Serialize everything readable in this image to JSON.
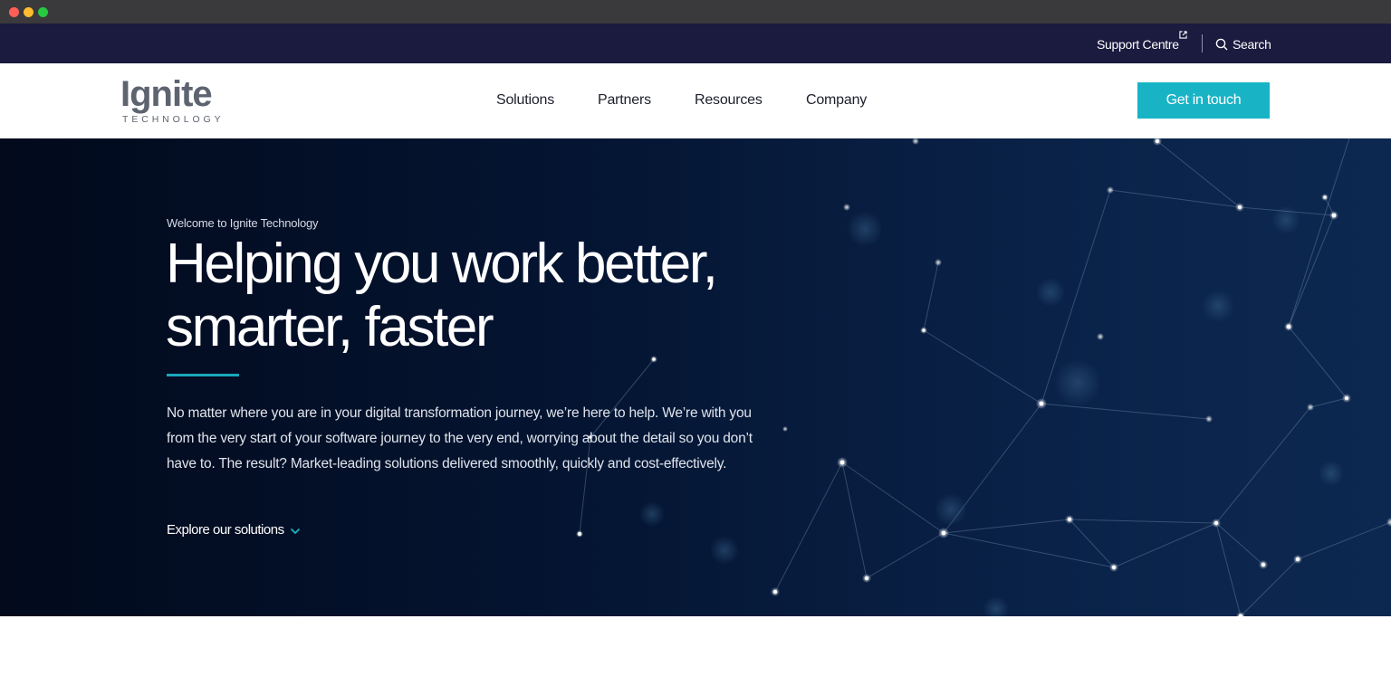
{
  "window": {
    "controls": [
      "close",
      "minimize",
      "maximize"
    ]
  },
  "utility_bar": {
    "support_label": "Support Centre",
    "support_icon": "external-link-icon",
    "search_label": "Search",
    "search_icon": "search-icon"
  },
  "header": {
    "logo_text": "Ignite",
    "logo_subtext": "TECHNOLOGY",
    "nav": [
      {
        "label": "Solutions"
      },
      {
        "label": "Partners"
      },
      {
        "label": "Resources"
      },
      {
        "label": "Company"
      }
    ],
    "cta_label": "Get in touch"
  },
  "hero": {
    "eyebrow": "Welcome to Ignite Technology",
    "title": "Helping you work better, smarter, faster",
    "body": "No matter where you are in your digital transformation journey, we’re here to help. We’re with you from the very start of your software journey to the very end, worrying about the detail so you don’t have to. The result? Market-leading solutions delivered smoothly, quickly and cost-effectively.",
    "link_label": "Explore our solutions",
    "link_icon": "chevron-down-icon"
  },
  "colors": {
    "utility_bg": "#1b1a3f",
    "accent": "#18b4c6",
    "hero_bg": "#041431",
    "logo_gray": "#5d6470"
  }
}
